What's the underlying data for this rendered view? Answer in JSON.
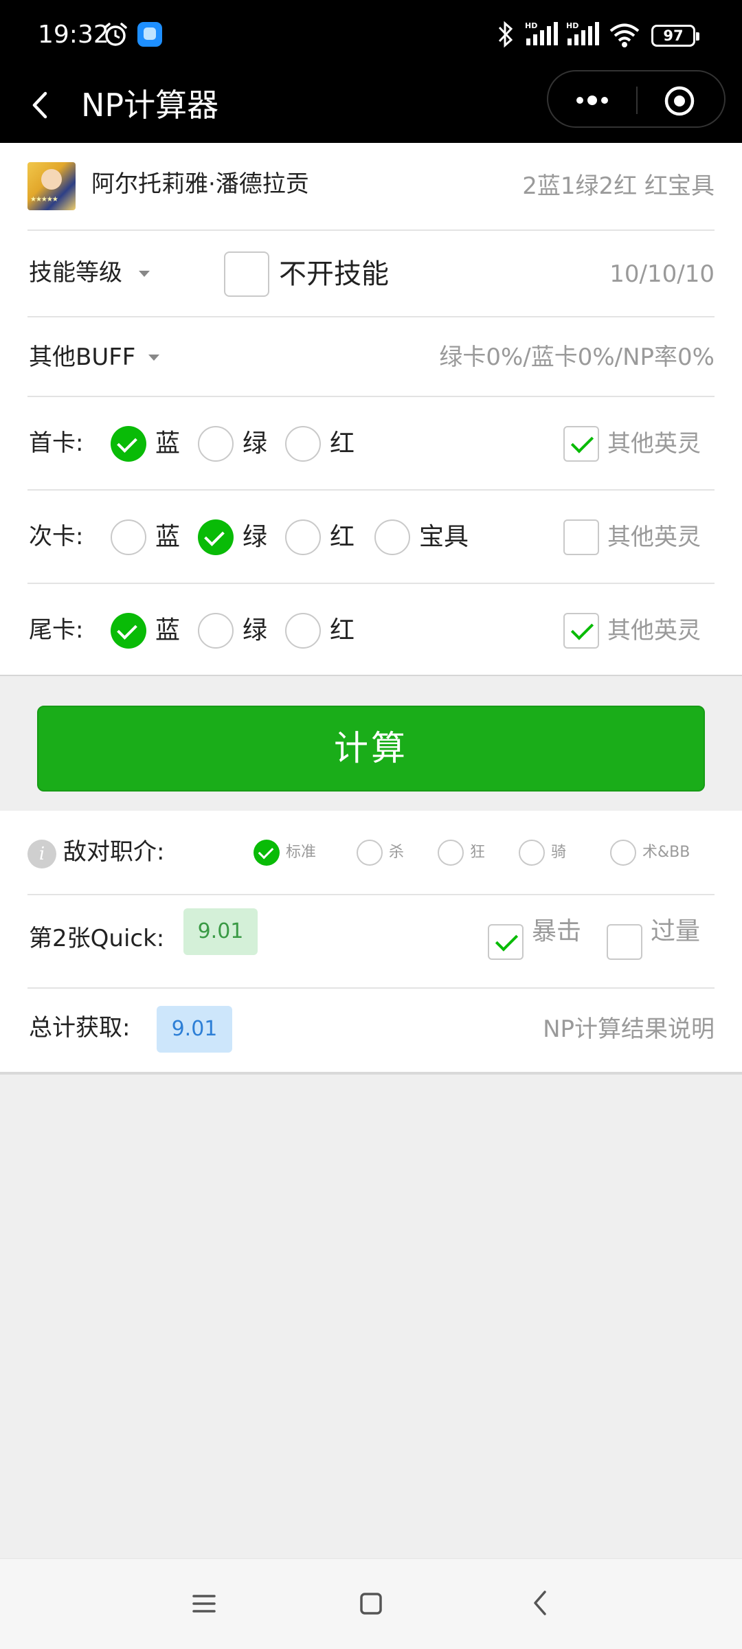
{
  "status_bar": {
    "time": "19:32",
    "signal1_label": "HD",
    "signal2_label": "HD",
    "battery": "97",
    "icons": [
      "alarm-icon",
      "app-notification-icon",
      "bluetooth-icon",
      "signal-icon",
      "signal-icon",
      "wifi-icon",
      "battery-icon"
    ]
  },
  "nav": {
    "title": "NP计算器",
    "back_icon": "chevron-left-icon",
    "more_icon": "more-dots-icon",
    "close_icon": "target-close-icon"
  },
  "servant": {
    "name": "阿尔托莉雅·潘德拉贡",
    "cards": "2蓝1绿2红 红宝具"
  },
  "skill": {
    "label": "技能等级",
    "toggle_label": "不开技能",
    "toggle_checked": false,
    "levels": "10/10/10"
  },
  "buff": {
    "label": "其他BUFF",
    "summary": "绿卡0%/蓝卡0%/NP率0%"
  },
  "cards": [
    {
      "label": "首卡:",
      "options": [
        {
          "label": "蓝",
          "selected": true
        },
        {
          "label": "绿",
          "selected": false
        },
        {
          "label": "红",
          "selected": false
        }
      ],
      "other_label": "其他英灵",
      "other_checked": true
    },
    {
      "label": "次卡:",
      "options": [
        {
          "label": "蓝",
          "selected": false
        },
        {
          "label": "绿",
          "selected": true
        },
        {
          "label": "红",
          "selected": false
        },
        {
          "label": "宝具",
          "selected": false
        }
      ],
      "other_label": "其他英灵",
      "other_checked": false
    },
    {
      "label": "尾卡:",
      "options": [
        {
          "label": "蓝",
          "selected": true
        },
        {
          "label": "绿",
          "selected": false
        },
        {
          "label": "红",
          "selected": false
        }
      ],
      "other_label": "其他英灵",
      "other_checked": true
    }
  ],
  "calculate_label": "计算",
  "enemy": {
    "info_glyph": "i",
    "label": "敌对职介:",
    "options": [
      {
        "label": "标准",
        "selected": true
      },
      {
        "label": "杀",
        "selected": false
      },
      {
        "label": "狂",
        "selected": false
      },
      {
        "label": "骑",
        "selected": false
      },
      {
        "label": "术&BB",
        "selected": false
      }
    ]
  },
  "result": {
    "card_label": "第2张Quick:",
    "card_value": "9.01",
    "crit_label": "暴击",
    "crit_checked": true,
    "overkill_label": "过量",
    "overkill_checked": false,
    "total_label": "总计获取:",
    "total_value": "9.01",
    "explain_link": "NP计算结果说明"
  },
  "system_nav": {
    "menu_icon": "menu-lines-icon",
    "home_icon": "home-square-icon",
    "back_icon": "back-arrow-icon"
  }
}
